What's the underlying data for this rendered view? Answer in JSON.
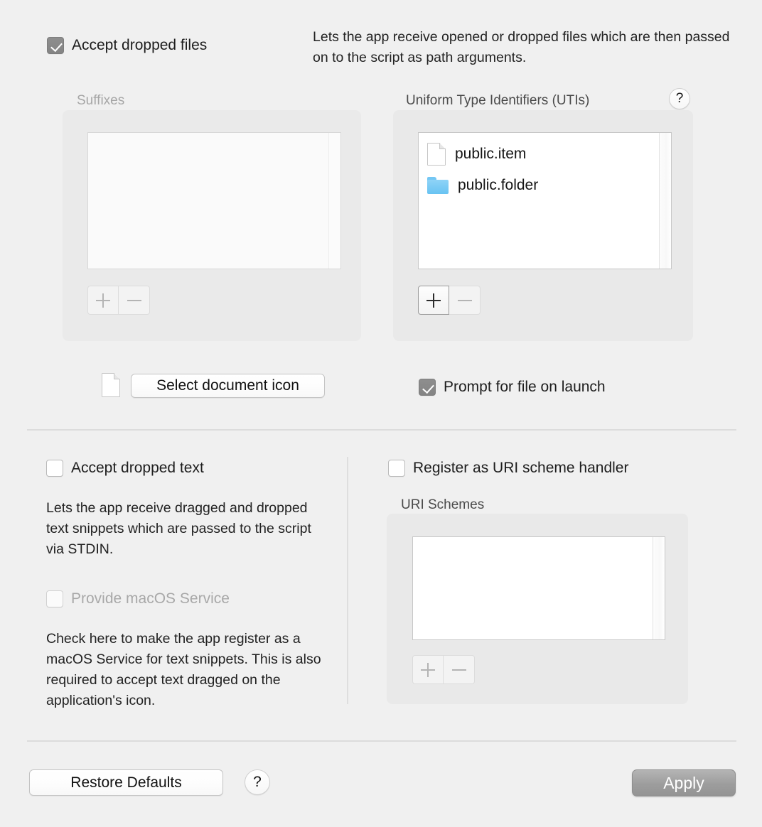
{
  "accept_files": {
    "checkbox_label": "Accept dropped files",
    "checked": true,
    "description": "Lets the app receive opened or dropped files which are then passed on to the script as path arguments."
  },
  "suffixes": {
    "group_label": "Suffixes",
    "items": [],
    "add_button": "+",
    "remove_button": "−",
    "add_enabled": false,
    "remove_enabled": false
  },
  "utis": {
    "group_label": "Uniform Type Identifiers (UTIs)",
    "help_button": "?",
    "items": [
      {
        "icon": "document-icon",
        "label": "public.item"
      },
      {
        "icon": "folder-icon",
        "label": "public.folder"
      }
    ],
    "add_button": "+",
    "remove_button": "−",
    "add_enabled": true,
    "remove_enabled": false
  },
  "document_icon_row": {
    "icon": "document-icon",
    "select_button": "Select document icon"
  },
  "prompt_for_file": {
    "checkbox_label": "Prompt for file on launch",
    "checked": true
  },
  "accept_text": {
    "checkbox_label": "Accept dropped text",
    "checked": false,
    "description": "Lets the app receive dragged and dropped text snippets which are passed to the script via STDIN."
  },
  "macos_service": {
    "checkbox_label": "Provide macOS Service",
    "checked": false,
    "disabled": true,
    "description": "Check here to make the app register as a macOS Service for text snippets. This is also required to accept text dragged on the application's icon."
  },
  "uri_handler": {
    "checkbox_label": "Register as URI scheme handler",
    "checked": false,
    "group_label": "URI Schemes",
    "items": [],
    "add_button": "+",
    "remove_button": "−",
    "add_enabled": false,
    "remove_enabled": false
  },
  "footer": {
    "restore_defaults": "Restore Defaults",
    "help_button": "?",
    "apply_button": "Apply",
    "apply_enabled": false
  },
  "colors": {
    "window_background": "#f0f0f0",
    "group_background": "#e9e9e9",
    "checkbox_checked": "#8a8a8a",
    "folder_icon": "#68c3f2",
    "apply_disabled": "#9d9d9d",
    "separator": "#dcdcdc",
    "disabled_text": "#a8a8a8"
  }
}
